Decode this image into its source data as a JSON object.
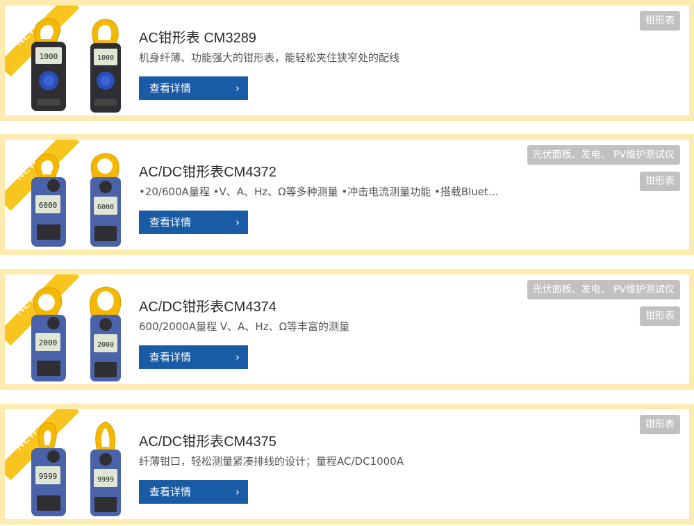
{
  "products": [
    {
      "badge": "NEW",
      "title": "AC钳形表 CM3289",
      "description": "机身纤薄、功能强大的钳形表，能轻松夹住狭窄处的配线",
      "button_label": "查看详情",
      "button_icon": "chevron-right-icon",
      "tags": [
        "钳形表"
      ],
      "display_readout": "1000"
    },
    {
      "badge": "NEW",
      "title": "AC/DC钳形表CM4372",
      "description": "•20/600A量程 •V、A、Hz、Ω等多种测量 •冲击电流测量功能 •搭载Bluet...",
      "button_label": "查看详情",
      "button_icon": "chevron-right-icon",
      "tags": [
        "光伏面板、发电、 PV维护测试仪",
        "钳形表"
      ],
      "display_readout": "6000"
    },
    {
      "badge": "NEW",
      "title": "AC/DC钳形表CM4374",
      "description": "600/2000A量程 V、A、Hz、Ω等丰富的测量",
      "button_label": "查看详情",
      "button_icon": "chevron-right-icon",
      "tags": [
        "光伏面板、发电、 PV维护测试仪",
        "钳形表"
      ],
      "display_readout": "2000"
    },
    {
      "badge": "NEW",
      "title": "AC/DC钳形表CM4375",
      "description": "纤薄钳口，轻松测量紧凑排线的设计；量程AC/DC1000A",
      "button_label": "查看详情",
      "button_icon": "chevron-right-icon",
      "tags": [
        "钳形表"
      ],
      "display_readout": "9999"
    }
  ],
  "colors": {
    "card_border": "#fdebb0",
    "ribbon": "#f7c51e",
    "button": "#1a5ba6",
    "tag": "#c1c1c1",
    "meter_body_black": "#2e2e33",
    "meter_body_blue": "#4a62a8",
    "jaw_yellow": "#f4b800"
  }
}
